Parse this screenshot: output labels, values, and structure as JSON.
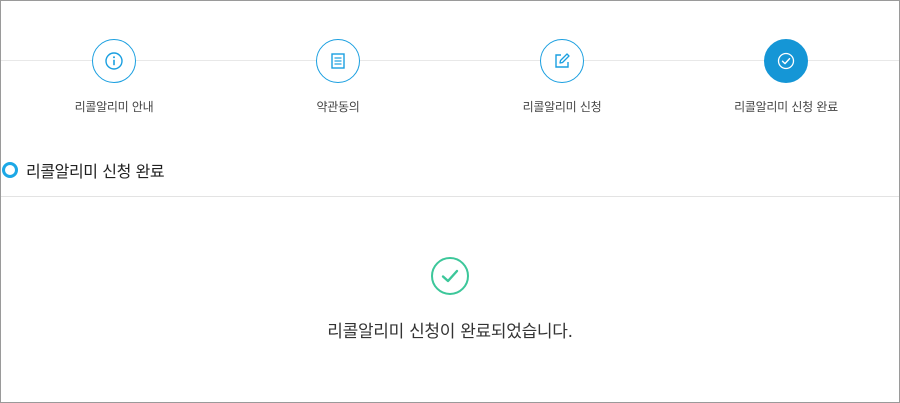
{
  "steps": [
    {
      "label": "리콜알리미 안내",
      "icon": "info-icon",
      "active": false
    },
    {
      "label": "약관동의",
      "icon": "document-icon",
      "active": false
    },
    {
      "label": "리콜알리미 신청",
      "icon": "edit-icon",
      "active": false
    },
    {
      "label": "리콜알리미 신청 완료",
      "icon": "check-icon",
      "active": true
    }
  ],
  "section": {
    "title": "리콜알리미 신청 완료"
  },
  "result": {
    "message": "리콜알리미 신청이 완료되었습니다.",
    "icon": "check-circle-icon"
  },
  "colors": {
    "accent": "#1596d6",
    "success": "#3cc79a",
    "border": "#9a9a9a"
  }
}
